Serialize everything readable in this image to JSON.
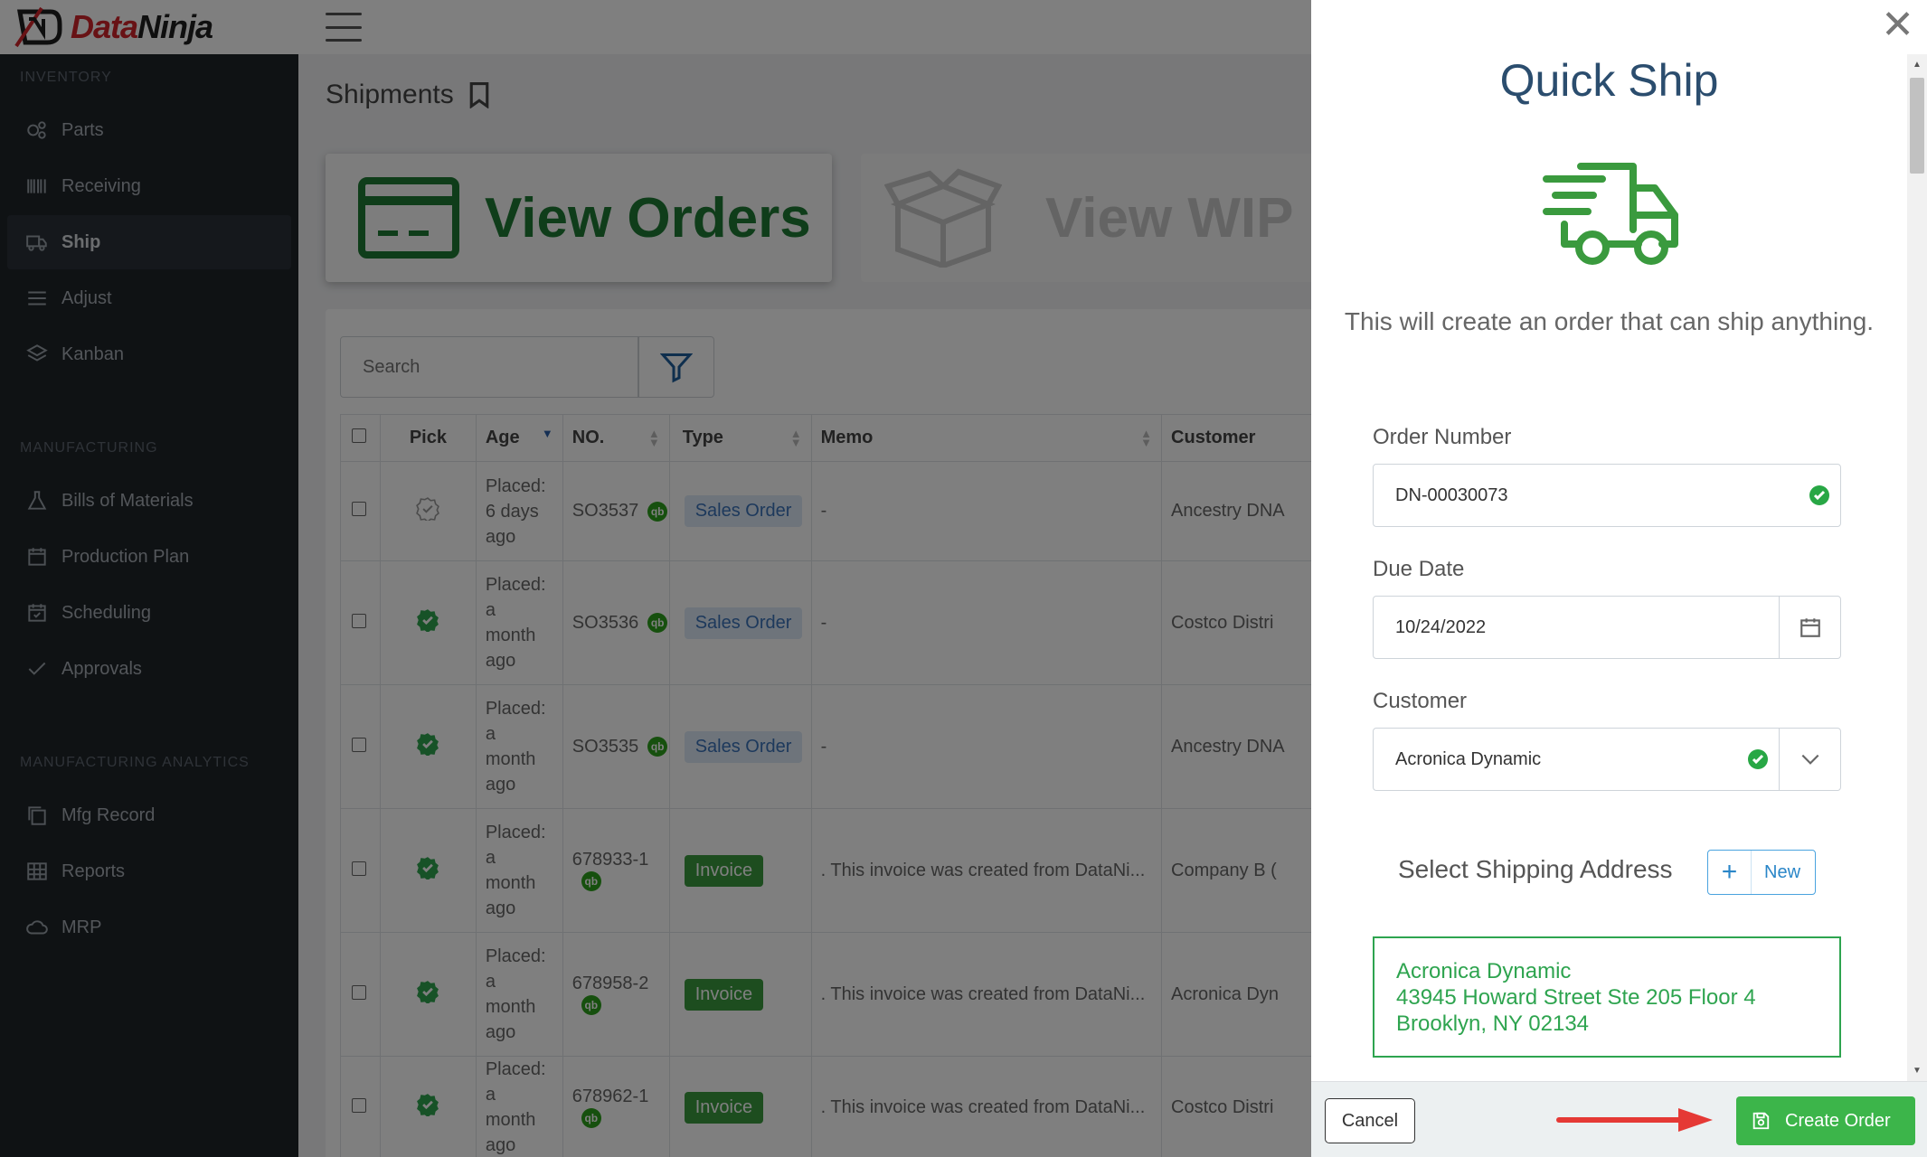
{
  "app": {
    "brand_prefix": "Data",
    "brand_suffix": "Ninja"
  },
  "sidebar": {
    "sections": [
      {
        "title": "INVENTORY"
      },
      {
        "title": "MANUFACTURING"
      },
      {
        "title": "MANUFACTURING ANALYTICS"
      }
    ],
    "items": [
      {
        "label": "Parts",
        "icon": "parts-icon"
      },
      {
        "label": "Receiving",
        "icon": "barcode-icon"
      },
      {
        "label": "Ship",
        "icon": "truck-icon",
        "active": true
      },
      {
        "label": "Adjust",
        "icon": "adjust-icon"
      },
      {
        "label": "Kanban",
        "icon": "layers-icon"
      },
      {
        "label": "Bills of Materials",
        "icon": "flask-icon"
      },
      {
        "label": "Production Plan",
        "icon": "calendar-icon"
      },
      {
        "label": "Scheduling",
        "icon": "calendar-check-icon"
      },
      {
        "label": "Approvals",
        "icon": "check-icon"
      },
      {
        "label": "Mfg Record",
        "icon": "copy-icon"
      },
      {
        "label": "Reports",
        "icon": "grid-icon"
      },
      {
        "label": "MRP",
        "icon": "cloud-icon"
      }
    ]
  },
  "main": {
    "title": "Shipments",
    "tiles": {
      "orders": "View Orders",
      "wip": "View WIP"
    },
    "search": {
      "placeholder": "Search"
    },
    "table": {
      "headers": [
        "Pick",
        "Age",
        "NO.",
        "Type",
        "Memo",
        "Customer"
      ],
      "rows": [
        {
          "pick": "pending",
          "age": [
            "Placed:",
            "6 days",
            "ago"
          ],
          "no": "SO3537",
          "type": "Sales Order",
          "memo": "-",
          "customer": "Ancestry DNA"
        },
        {
          "pick": "done",
          "age": [
            "Placed:",
            "a",
            "month",
            "ago"
          ],
          "no": "SO3536",
          "type": "Sales Order",
          "memo": "-",
          "customer": "Costco Distri"
        },
        {
          "pick": "done",
          "age": [
            "Placed:",
            "a",
            "month",
            "ago"
          ],
          "no": "SO3535",
          "type": "Sales Order",
          "memo": "-",
          "customer": "Ancestry DNA"
        },
        {
          "pick": "done",
          "age": [
            "Placed:",
            "a",
            "month",
            "ago"
          ],
          "no": "678933-1",
          "type": "Invoice",
          "memo": ". This invoice was created from DataNi...",
          "customer": "Company B ("
        },
        {
          "pick": "done",
          "age": [
            "Placed:",
            "a",
            "month",
            "ago"
          ],
          "no": "678958-2",
          "type": "Invoice",
          "memo": ". This invoice was created from DataNi...",
          "customer": "Acronica Dyn"
        },
        {
          "pick": "done",
          "age": [
            "Placed:",
            "a",
            "month",
            "ago"
          ],
          "no": "678962-1",
          "type": "Invoice",
          "memo": ". This invoice was created from DataNi...",
          "customer": "Costco Distri"
        }
      ]
    }
  },
  "drawer": {
    "title": "Quick Ship",
    "subtitle": "This will create an order that can ship anything.",
    "order_number": {
      "label": "Order Number",
      "value": "DN-00030073"
    },
    "due_date": {
      "label": "Due Date",
      "value": "10/24/2022"
    },
    "customer": {
      "label": "Customer",
      "value": "Acronica Dynamic"
    },
    "shipping": {
      "title": "Select Shipping Address",
      "new_label": "New",
      "address": {
        "name": "Acronica Dynamic",
        "line1": "43945 Howard Street Ste 205 Floor 4",
        "line2": "Brooklyn, NY 02134"
      }
    },
    "footer": {
      "cancel": "Cancel",
      "create": "Create Order"
    }
  },
  "colors": {
    "accent_green": "#3cb54a",
    "brand_red": "#d0242b",
    "sidebar_bg": "#1f2429",
    "annotation_arrow": "#e53935"
  }
}
